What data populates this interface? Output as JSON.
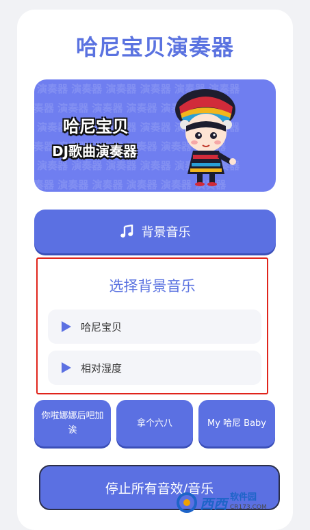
{
  "app": {
    "title": "哈尼宝贝演奏器"
  },
  "banner": {
    "title": "哈尼宝贝",
    "subtitle": "DJ歌曲演奏器",
    "pattern_text": "演奏器 演奏器 演奏器 演奏器 演奏器 演奏器",
    "mascot_icon": "mascot-girl-in-traditional-hat"
  },
  "bg_music_button": {
    "label": "背景音乐",
    "icon": "music-note-icon"
  },
  "bg_music_panel": {
    "title": "选择背景音乐",
    "tracks": [
      {
        "label": "哈尼宝贝",
        "icon": "play-icon"
      },
      {
        "label": "相对湿度",
        "icon": "play-icon"
      }
    ]
  },
  "sound_buttons": [
    {
      "label": "你啦娜娜后吧加诶"
    },
    {
      "label": "拿个六八"
    },
    {
      "label": "My 哈尼 Baby"
    }
  ],
  "stop_button": {
    "label": "停止所有音效/音乐"
  },
  "watermark": {
    "main": "西西",
    "sub": "软件园",
    "url": "CR173.COM"
  },
  "colors": {
    "accent": "#5b70e2",
    "title": "#5a72e0",
    "highlight_border": "#e0241b"
  }
}
